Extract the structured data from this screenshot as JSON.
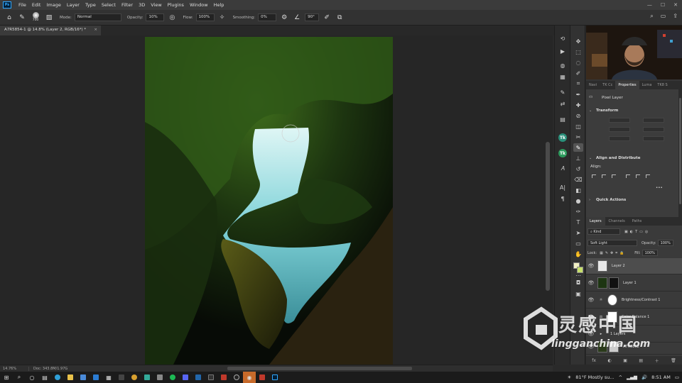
{
  "app": {
    "logo": "Ps",
    "menu": [
      "File",
      "Edit",
      "Image",
      "Layer",
      "Type",
      "Select",
      "Filter",
      "3D",
      "View",
      "Plugins",
      "Window",
      "Help"
    ],
    "window_controls": [
      "—",
      "☐",
      "✕"
    ]
  },
  "options_bar": {
    "brush_size": "700",
    "mode_label": "Mode:",
    "mode_value": "Normal",
    "opacity_label": "Opacity:",
    "opacity_value": "10%",
    "flow_label": "Flow:",
    "flow_value": "100%",
    "smoothing_label": "Smoothing:",
    "smoothing_value": "0%",
    "angle_value": "90°"
  },
  "document": {
    "tab_title": "A7R5854-1 @ 14.8% (Layer 2, RGB/16*) *",
    "close": "×"
  },
  "status": {
    "zoom": "14.76%",
    "doc": "Doc: 343.8M/1.97G"
  },
  "right_panel": {
    "tabs": [
      "Navi",
      "TK Cc",
      "Properties",
      "Luma",
      "TK8 S"
    ],
    "active_tab": "Properties",
    "pixel_layer": "Pixel Layer",
    "transform_heading": "Transform",
    "align_heading": "Align and Distribute",
    "align_label": "Align:",
    "quick_actions": "Quick Actions",
    "more": "•••"
  },
  "layers_panel": {
    "tabs": [
      "Layers",
      "Channels",
      "Paths"
    ],
    "kind_label": "Kind",
    "blend_mode": "Soft Light",
    "opacity_label": "Opacity:",
    "opacity_value": "100%",
    "lock_label": "Lock:",
    "fill_label": "Fill:",
    "fill_value": "100%",
    "layers": [
      {
        "name": "Layer 2",
        "selected": true
      },
      {
        "name": "Layer 1",
        "selected": false
      },
      {
        "name": "Brightness/Contrast 1",
        "selected": false
      },
      {
        "name": "Color Balance 1",
        "selected": false
      },
      {
        "name": "1 Layers",
        "selected": false
      },
      {
        "name": "A7R5862",
        "selected": false
      }
    ],
    "footer_icons": [
      "fx",
      "◐",
      "▣",
      "▤",
      "＋",
      "🗑"
    ]
  },
  "watermark": {
    "brand": "灵感中国",
    "url": "lingganchina.com"
  },
  "taskbar": {
    "weather": "81°F  Mostly su...",
    "time": "8:51 AM"
  },
  "colors": {
    "accent": "#31a8ff",
    "panel": "#353535",
    "selected_layer": "#4d4d4d",
    "water": "#7fd2d8"
  }
}
